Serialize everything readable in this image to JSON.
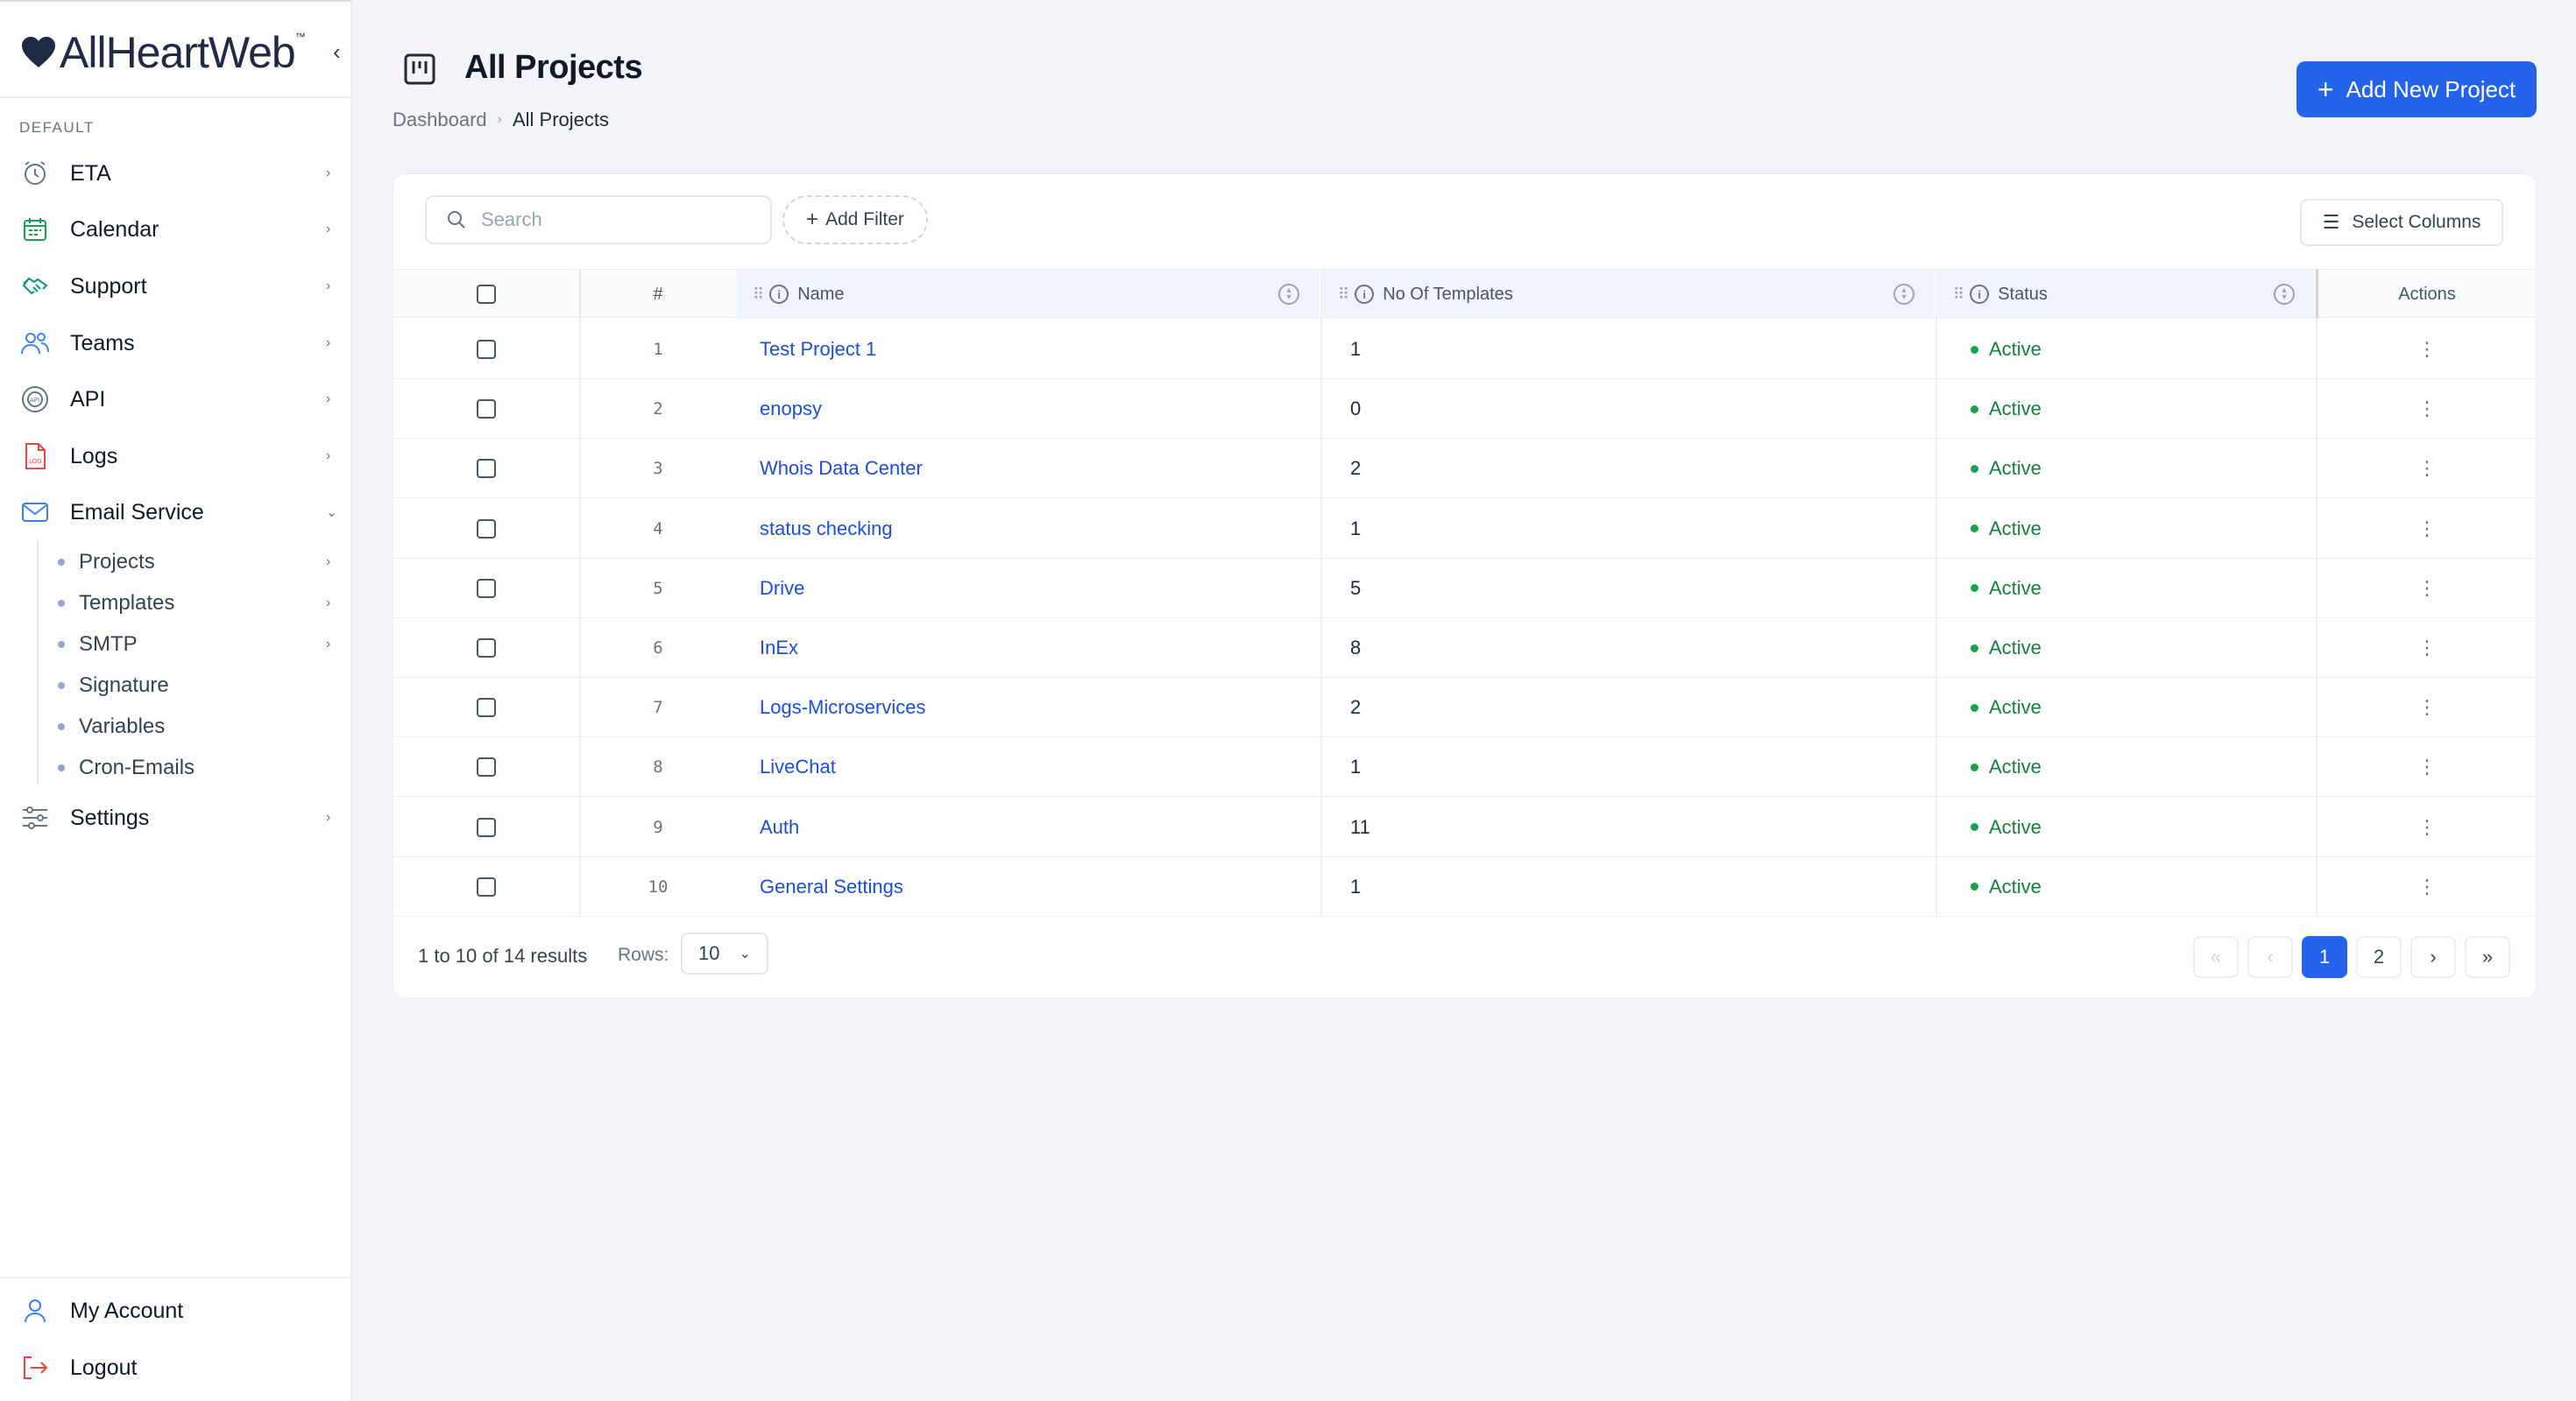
{
  "brand": {
    "name": "AllHeartWeb",
    "tm": "™",
    "heart_color": "#1f2a44"
  },
  "sidebar": {
    "section_label": "DEFAULT",
    "items": [
      {
        "label": "ETA",
        "icon": "alarm-clock-icon"
      },
      {
        "label": "Calendar",
        "icon": "calendar-icon"
      },
      {
        "label": "Support",
        "icon": "handshake-icon"
      },
      {
        "label": "Teams",
        "icon": "users-icon"
      },
      {
        "label": "API",
        "icon": "api-icon"
      },
      {
        "label": "Logs",
        "icon": "log-file-icon"
      },
      {
        "label": "Email Service",
        "icon": "mail-icon"
      }
    ],
    "sub_items": [
      {
        "label": "Projects"
      },
      {
        "label": "Templates"
      },
      {
        "label": "SMTP"
      },
      {
        "label": "Signature"
      },
      {
        "label": "Variables"
      },
      {
        "label": "Cron-Emails"
      }
    ],
    "settings_label": "Settings",
    "account_label": "My Account",
    "logout_label": "Logout"
  },
  "header": {
    "title": "All Projects",
    "breadcrumb": {
      "home": "Dashboard",
      "current": "All Projects"
    },
    "add_button_label": "Add New Project"
  },
  "toolbar": {
    "search_placeholder": "Search",
    "add_filter_label": "Add Filter",
    "select_columns_label": "Select Columns"
  },
  "table": {
    "headers": {
      "num": "#",
      "name": "Name",
      "templates": "No Of Templates",
      "status": "Status",
      "actions": "Actions"
    },
    "rows": [
      {
        "num": "1",
        "name": "Test Project 1",
        "templates": "1",
        "status": "Active"
      },
      {
        "num": "2",
        "name": "enopsy",
        "templates": "0",
        "status": "Active"
      },
      {
        "num": "3",
        "name": "Whois Data Center",
        "templates": "2",
        "status": "Active"
      },
      {
        "num": "4",
        "name": "status checking",
        "templates": "1",
        "status": "Active"
      },
      {
        "num": "5",
        "name": "Drive",
        "templates": "5",
        "status": "Active"
      },
      {
        "num": "6",
        "name": "InEx",
        "templates": "8",
        "status": "Active"
      },
      {
        "num": "7",
        "name": "Logs-Microservices",
        "templates": "2",
        "status": "Active"
      },
      {
        "num": "8",
        "name": "LiveChat",
        "templates": "1",
        "status": "Active"
      },
      {
        "num": "9",
        "name": "Auth",
        "templates": "11",
        "status": "Active"
      },
      {
        "num": "10",
        "name": "General Settings",
        "templates": "1",
        "status": "Active"
      }
    ]
  },
  "pagination": {
    "summary": "1 to 10 of 14 results",
    "rows_label": "Rows:",
    "rows_value": "10",
    "first": "«",
    "prev": "‹",
    "pages": [
      "1",
      "2"
    ],
    "next": "›",
    "last": "»"
  },
  "colors": {
    "accent": "#2563eb",
    "link": "#1d4ed8",
    "active": "#15803d"
  }
}
